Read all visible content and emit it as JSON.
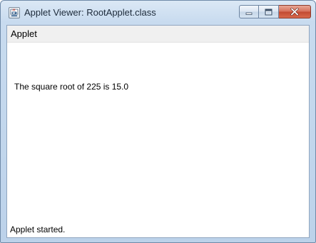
{
  "window": {
    "title": "Applet Viewer: RootApplet.class",
    "icon": "java-applet-icon",
    "buttons": {
      "minimize": "minimize-icon",
      "maximize": "maximize-icon",
      "close": "close-icon"
    },
    "colors": {
      "frame": "#c8dbef",
      "close_button": "#c24a32"
    }
  },
  "menubar": {
    "items": [
      {
        "label": "Applet"
      }
    ]
  },
  "applet": {
    "output": "The square root of 225 is 15.0"
  },
  "status": {
    "text": "Applet started."
  }
}
